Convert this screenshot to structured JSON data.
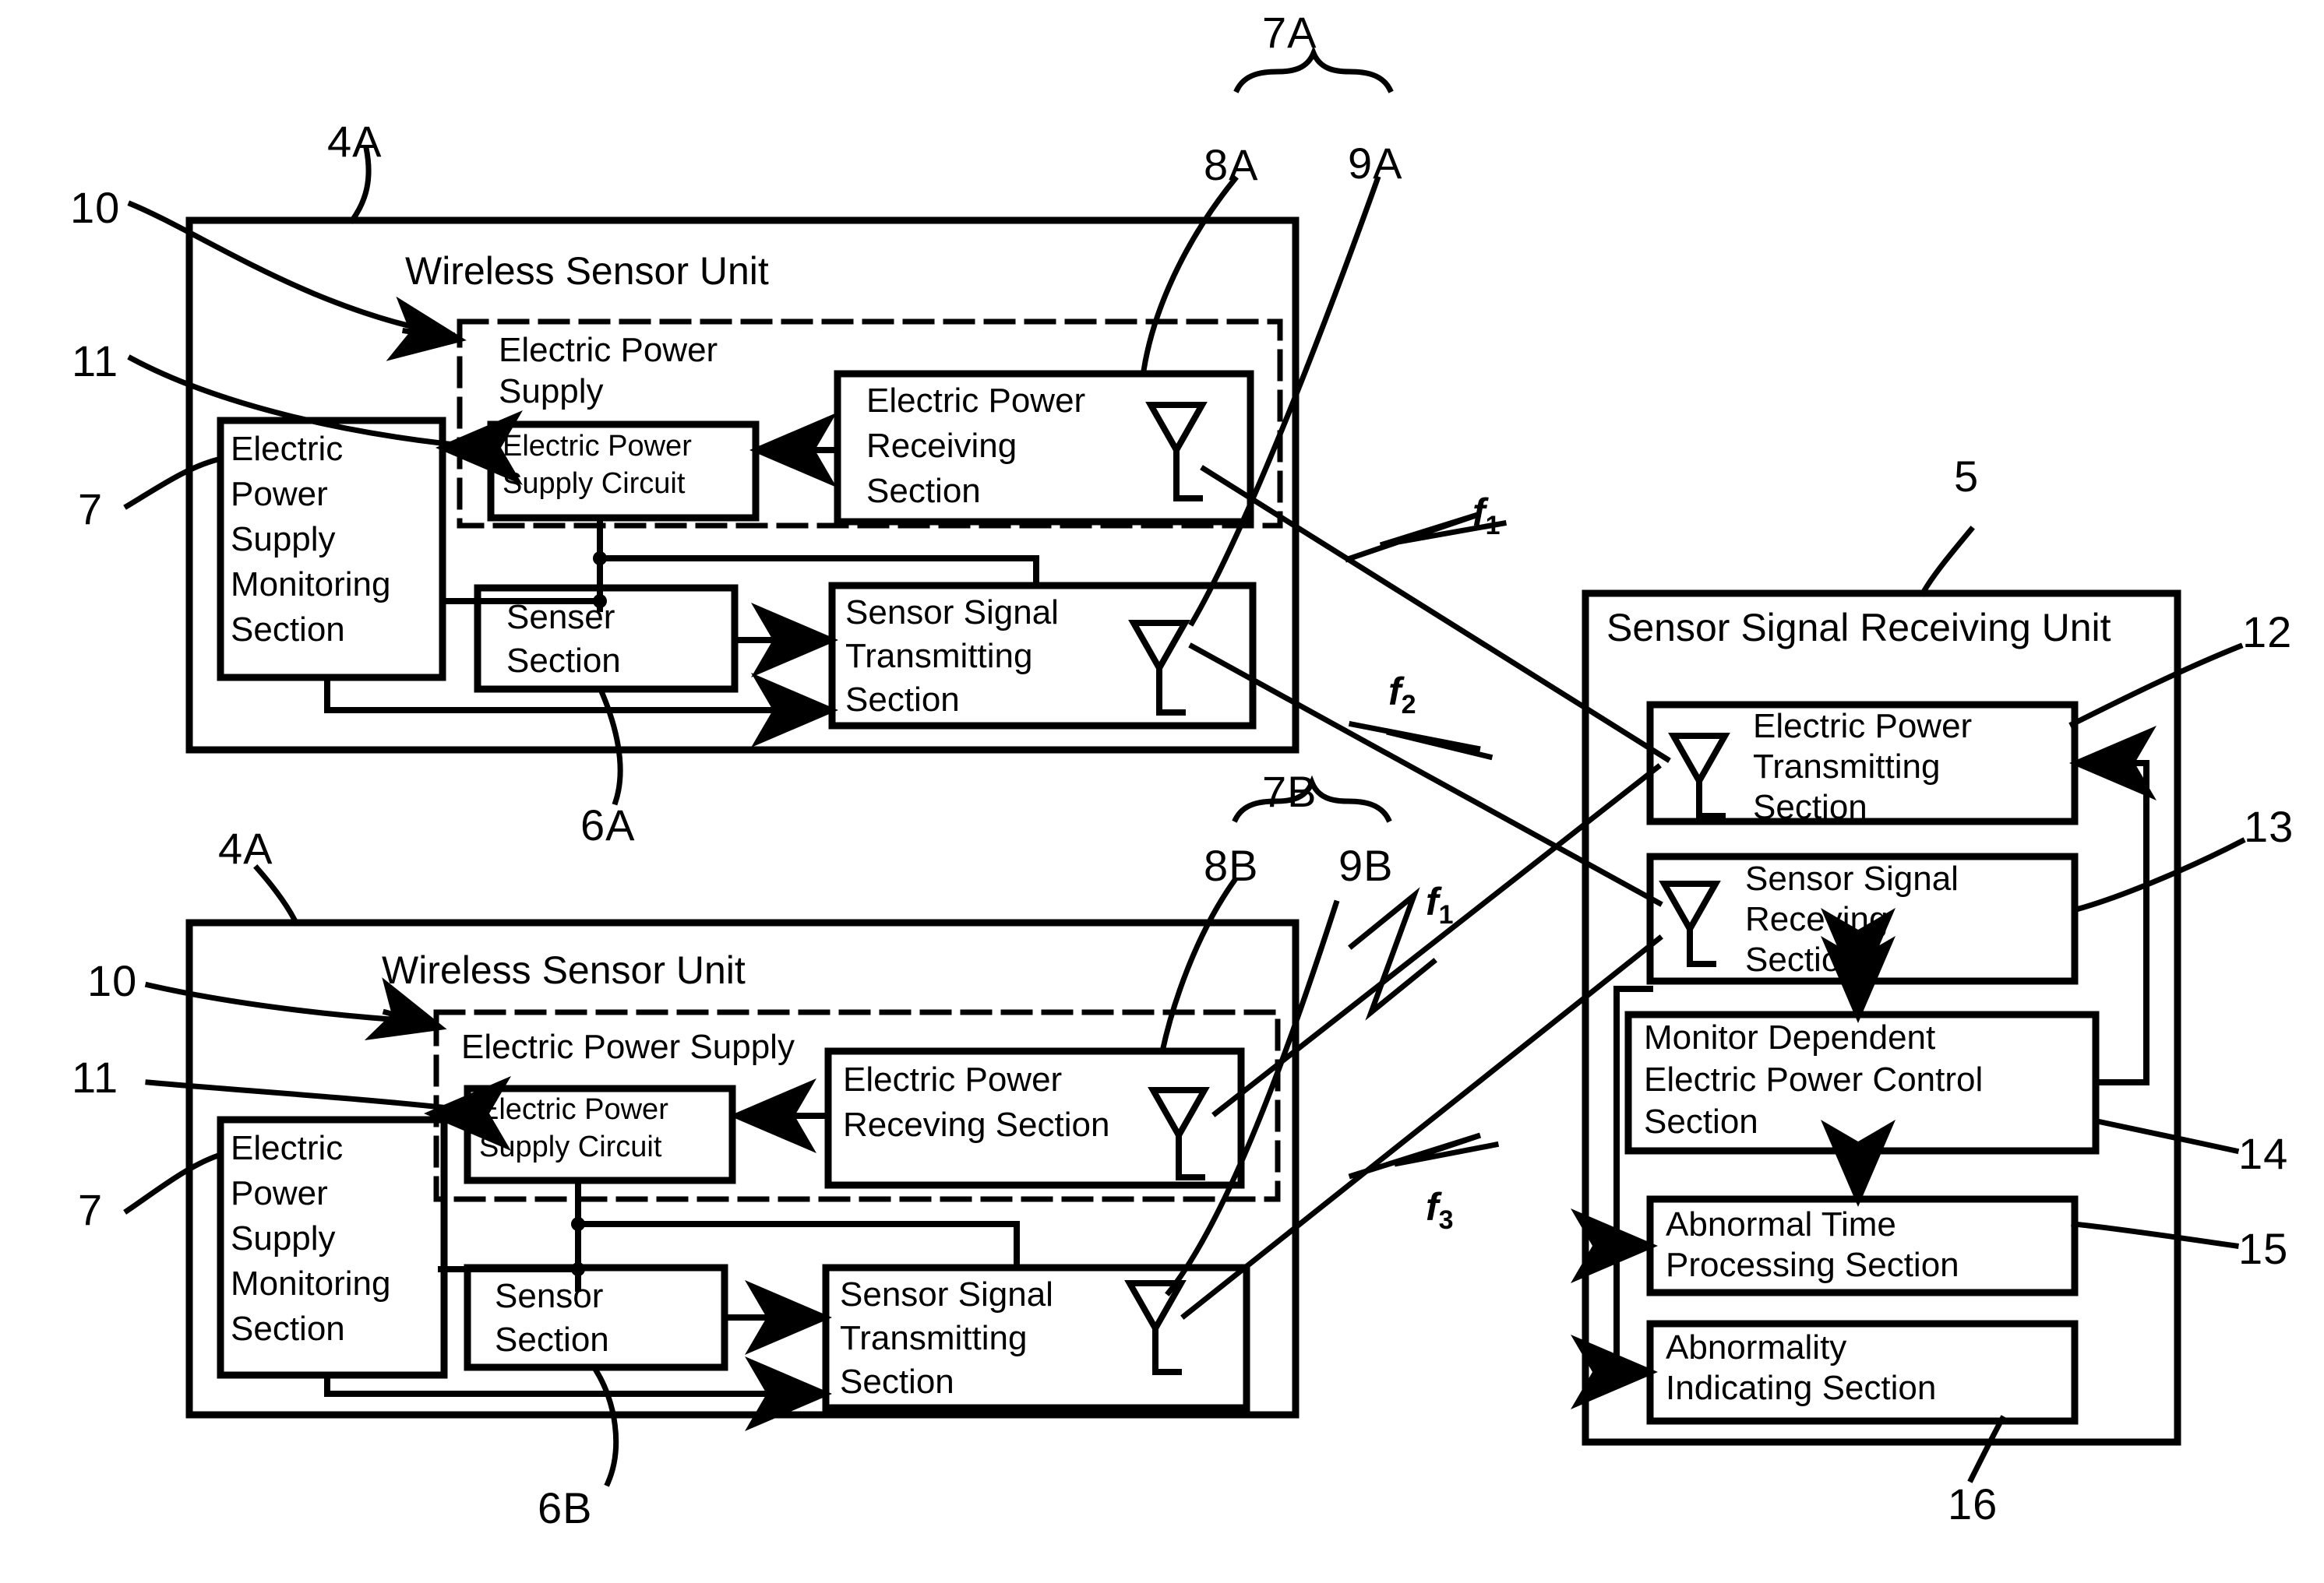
{
  "figure": {
    "type": "patent-block-diagram",
    "description": "Wireless sensor system block diagram with two wireless sensor units and a sensor signal receiving unit"
  },
  "reference_numerals": {
    "n4A_top": "4A",
    "n4A_bottom": "4A",
    "n10_top": "10",
    "n10_bottom": "10",
    "n11_top": "11",
    "n11_bottom": "11",
    "n7_top": "7",
    "n7_bottom": "7",
    "n6A": "6A",
    "n6B": "6B",
    "n7A": "7A",
    "n7B": "7B",
    "n8A": "8A",
    "n8B": "8B",
    "n9A": "9A",
    "n9B": "9B",
    "n5": "5",
    "n12": "12",
    "n13": "13",
    "n14": "14",
    "n15": "15",
    "n16": "16"
  },
  "sensor_unit_top": {
    "title": "Wireless Sensor Unit",
    "power_supply_label_line1": "Electric Power",
    "power_supply_label_line2": "Supply",
    "power_supply_circuit_line1": "Electric Power",
    "power_supply_circuit_line2": "Supply Circuit",
    "power_receiving_line1": "Electric Power",
    "power_receiving_line2": "Receiving",
    "power_receiving_line3": "Section",
    "monitoring_line1": "Electric",
    "monitoring_line2": "Power",
    "monitoring_line3": "Supply",
    "monitoring_line4": "Monitoring",
    "monitoring_line5": "Section",
    "sensor_section_line1": "Senser",
    "sensor_section_line2": "Section",
    "signal_tx_line1": "Sensor Signal",
    "signal_tx_line2": "Transmitting",
    "signal_tx_line3": "Section"
  },
  "sensor_unit_bottom": {
    "title": "Wireless Sensor Unit",
    "power_supply_label": "Electric Power Supply",
    "power_supply_circuit_line1": "Electric Power",
    "power_supply_circuit_line2": "Supply Circuit",
    "power_receiving_line1": "Electric Power",
    "power_receiving_line2": "Receving Section",
    "monitoring_line1": "Electric",
    "monitoring_line2": "Power",
    "monitoring_line3": "Supply",
    "monitoring_line4": "Monitoring",
    "monitoring_line5": "Section",
    "sensor_section_line1": "Sensor",
    "sensor_section_line2": "Section",
    "signal_tx_line1": "Sensor Signal",
    "signal_tx_line2": "Transmitting",
    "signal_tx_line3": "Section"
  },
  "receiving_unit": {
    "title": "Sensor Signal Receiving Unit",
    "power_tx_line1": "Electric Power",
    "power_tx_line2": "Transmitting",
    "power_tx_line3": "Section",
    "signal_rx_line1": "Sensor Signal",
    "signal_rx_line2": "Receving",
    "signal_rx_line3": "Section",
    "monitor_ctrl_line1": "Monitor Dependent",
    "monitor_ctrl_line2": "Electric Power Control",
    "monitor_ctrl_line3": "Section",
    "abnormal_time_line1": "Abnormal Time",
    "abnormal_time_line2": "Processing Section",
    "abnormality_line1": "Abnormality",
    "abnormality_line2": "Indicating Section"
  },
  "frequencies": {
    "f1_top": "f",
    "f1_top_sub": "1",
    "f2": "f",
    "f2_sub": "2",
    "f1_bottom": "f",
    "f1_bottom_sub": "1",
    "f3": "f",
    "f3_sub": "3"
  },
  "colors": {
    "ink": "#000000",
    "paper": "#ffffff"
  }
}
